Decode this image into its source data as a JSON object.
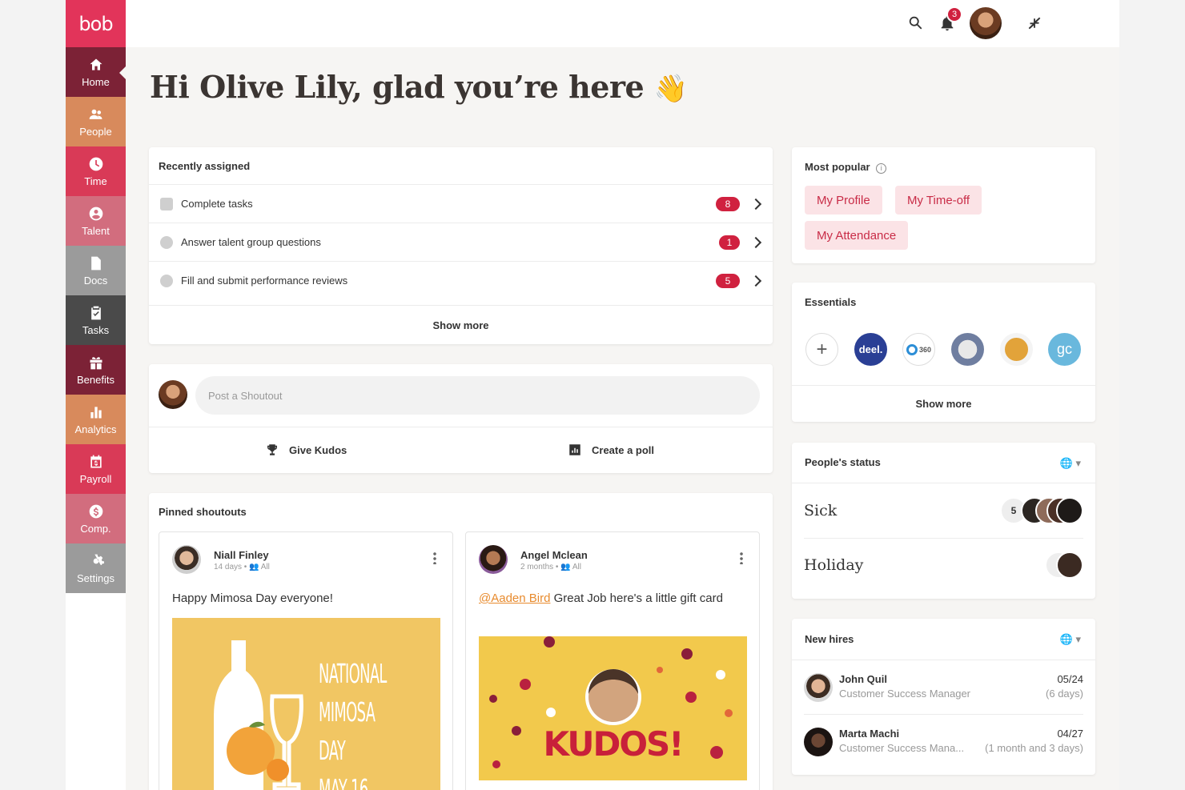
{
  "app": {
    "logo": "bob",
    "accent": "#e2345a"
  },
  "sidebar": {
    "items": [
      {
        "label": "Home",
        "icon": "home-icon",
        "color": "#7c2236"
      },
      {
        "label": "People",
        "icon": "people-icon",
        "color": "#d88a5c"
      },
      {
        "label": "Time",
        "icon": "clock-icon",
        "color": "#d93a57"
      },
      {
        "label": "Talent",
        "icon": "talent-icon",
        "color": "#d26d7e"
      },
      {
        "label": "Docs",
        "icon": "document-icon",
        "color": "#9b9b9b"
      },
      {
        "label": "Tasks",
        "icon": "clipboard-check-icon",
        "color": "#4a4a4a"
      },
      {
        "label": "Benefits",
        "icon": "gift-icon",
        "color": "#7c2236"
      },
      {
        "label": "Analytics",
        "icon": "bar-chart-icon",
        "color": "#d88a5c"
      },
      {
        "label": "Payroll",
        "icon": "calendar-dollar-icon",
        "color": "#d93a57"
      },
      {
        "label": "Comp.",
        "icon": "dollar-circle-icon",
        "color": "#d26d7e"
      },
      {
        "label": "Settings",
        "icon": "gear-icon",
        "color": "#9b9b9b"
      }
    ]
  },
  "topbar": {
    "notification_count": "3"
  },
  "greeting": {
    "text": "Hi Olive Lily, glad you’re here",
    "emoji": "👋"
  },
  "recently_assigned": {
    "title": "Recently assigned",
    "items": [
      {
        "label": "Complete tasks",
        "count": "8"
      },
      {
        "label": "Answer talent group questions",
        "count": "1"
      },
      {
        "label": "Fill and submit performance reviews",
        "count": "5"
      }
    ],
    "show_more": "Show more"
  },
  "shoutout": {
    "placeholder": "Post a Shoutout",
    "give_kudos": "Give Kudos",
    "create_poll": "Create a poll"
  },
  "pinned": {
    "title": "Pinned shoutouts",
    "posts": [
      {
        "name": "Niall Finley",
        "time": "14 days",
        "audience": "All",
        "text": "Happy Mimosa Day everyone!",
        "image_text": [
          "NATIONAL",
          "MIMOSA DAY",
          "MAY 16"
        ]
      },
      {
        "name": "Angel Mclean",
        "time": "2 months",
        "audience": "All",
        "mention": "@Aaden Bird",
        "text": " Great Job here's a little gift card",
        "image_text": "KUDOS!"
      }
    ]
  },
  "most_popular": {
    "title": "Most popular",
    "chips": [
      "My Profile",
      "My Time-off",
      "My Attendance"
    ]
  },
  "essentials": {
    "title": "Essentials",
    "apps": [
      "deel.",
      "360",
      "gc"
    ],
    "show_more": "Show more"
  },
  "peoples_status": {
    "title": "People's status",
    "rows": [
      {
        "label": "Sick",
        "count": "5"
      },
      {
        "label": "Holiday",
        "count": "1"
      }
    ]
  },
  "new_hires": {
    "title": "New hires",
    "hires": [
      {
        "name": "John Quil",
        "title": "Customer Success Manager",
        "date": "05/24",
        "ago": "(6 days)"
      },
      {
        "name": "Marta Machi",
        "title": "Customer Success Mana...",
        "date": "04/27",
        "ago": "(1 month and 3 days)"
      }
    ]
  }
}
